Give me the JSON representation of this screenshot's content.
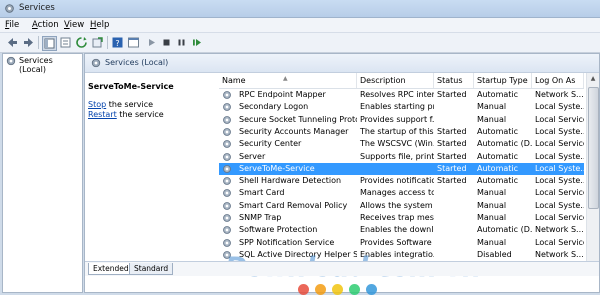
{
  "window": {
    "title": "Services"
  },
  "menu": [
    {
      "accel": "F",
      "rest": "ile"
    },
    {
      "accel": "A",
      "rest": "ction"
    },
    {
      "accel": "V",
      "rest": "iew"
    },
    {
      "accel": "H",
      "rest": "elp"
    }
  ],
  "toolbar": {
    "buttons": [
      "back-icon",
      "forward-icon",
      "show-tree-icon",
      "properties-icon",
      "refresh-icon",
      "export-icon",
      "help-icon",
      "console-icon",
      "play-icon",
      "stop-icon",
      "pause-icon",
      "restart-icon"
    ]
  },
  "tree": {
    "root_label": "Services (Local)"
  },
  "panel": {
    "header": "Services (Local)",
    "selected_service": "ServeToMe-Service",
    "stop_link": "Stop",
    "stop_rest": " the service",
    "restart_link": "Restart",
    "restart_rest": " the service"
  },
  "table": {
    "columns": [
      "Name",
      "Description",
      "Status",
      "Startup Type",
      "Log On As"
    ],
    "rows": [
      {
        "name": "RPC Endpoint Mapper",
        "description": "Resolves RPC inter...",
        "status": "Started",
        "startup": "Automatic",
        "logon": "Network S..."
      },
      {
        "name": "Secondary Logon",
        "description": "Enables starting pr...",
        "status": "",
        "startup": "Manual",
        "logon": "Local Syste..."
      },
      {
        "name": "Secure Socket Tunneling Protocol ...",
        "description": "Provides support f...",
        "status": "",
        "startup": "Manual",
        "logon": "Local Service"
      },
      {
        "name": "Security Accounts Manager",
        "description": "The startup of this ...",
        "status": "Started",
        "startup": "Automatic",
        "logon": "Local Syste..."
      },
      {
        "name": "Security Center",
        "description": "The WSCSVC (Win...",
        "status": "Started",
        "startup": "Automatic (D...",
        "logon": "Local Service"
      },
      {
        "name": "Server",
        "description": "Supports file, print,...",
        "status": "Started",
        "startup": "Automatic",
        "logon": "Local Syste..."
      },
      {
        "name": "ServeToMe-Service",
        "description": "",
        "status": "Started",
        "startup": "Automatic",
        "logon": "Local Syste...",
        "selected": true
      },
      {
        "name": "Shell Hardware Detection",
        "description": "Provides notificatio...",
        "status": "Started",
        "startup": "Automatic",
        "logon": "Local Syste..."
      },
      {
        "name": "Smart Card",
        "description": "Manages access to...",
        "status": "",
        "startup": "Manual",
        "logon": "Local Service"
      },
      {
        "name": "Smart Card Removal Policy",
        "description": "Allows the system ...",
        "status": "",
        "startup": "Manual",
        "logon": "Local Syste..."
      },
      {
        "name": "SNMP Trap",
        "description": "Receives trap mess...",
        "status": "",
        "startup": "Manual",
        "logon": "Local Service"
      },
      {
        "name": "Software Protection",
        "description": "Enables the downl...",
        "status": "",
        "startup": "Automatic (D...",
        "logon": "Network S..."
      },
      {
        "name": "SPP Notification Service",
        "description": "Provides Software ...",
        "status": "",
        "startup": "Manual",
        "logon": "Local Service"
      },
      {
        "name": "SQL Active Directory Helper Service",
        "description": "Enables integratio...",
        "status": "",
        "startup": "Disabled",
        "logon": "Network S..."
      }
    ]
  },
  "tabs": [
    "Extended",
    "Standard"
  ],
  "watermark": {
    "text": "Download.com.vn"
  },
  "colors": {
    "selection": "#3399ff",
    "link": "#0645ad",
    "watermark_dots": [
      "#e74c3c",
      "#f39c12",
      "#f1c40f",
      "#2ecc71",
      "#3498db"
    ]
  }
}
